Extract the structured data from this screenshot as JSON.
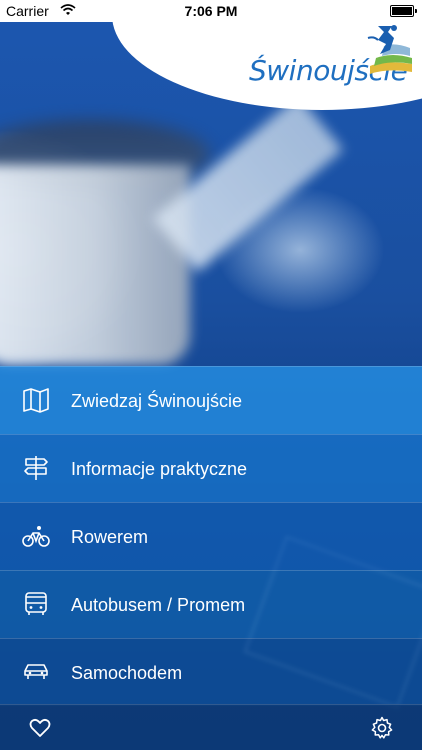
{
  "status_bar": {
    "carrier": "Carrier",
    "time": "7:06 PM",
    "battery_level": 1.0
  },
  "logo": {
    "text": "Świnoujście",
    "emblem_icon": "city-emblem-icon"
  },
  "menu": {
    "items": [
      {
        "label": "Zwiedzaj Świnoujście",
        "icon": "map-icon"
      },
      {
        "label": "Informacje praktyczne",
        "icon": "signpost-icon"
      },
      {
        "label": "Rowerem",
        "icon": "bicycle-icon"
      },
      {
        "label": "Autobusem / Promem",
        "icon": "bus-icon"
      },
      {
        "label": "Samochodem",
        "icon": "car-icon"
      }
    ]
  },
  "bottom_bar": {
    "left_icon": "heart-icon",
    "right_icon": "gear-icon"
  },
  "colors": {
    "brand_blue": "#1f6fc0",
    "menu_highlight": "#248de2"
  }
}
